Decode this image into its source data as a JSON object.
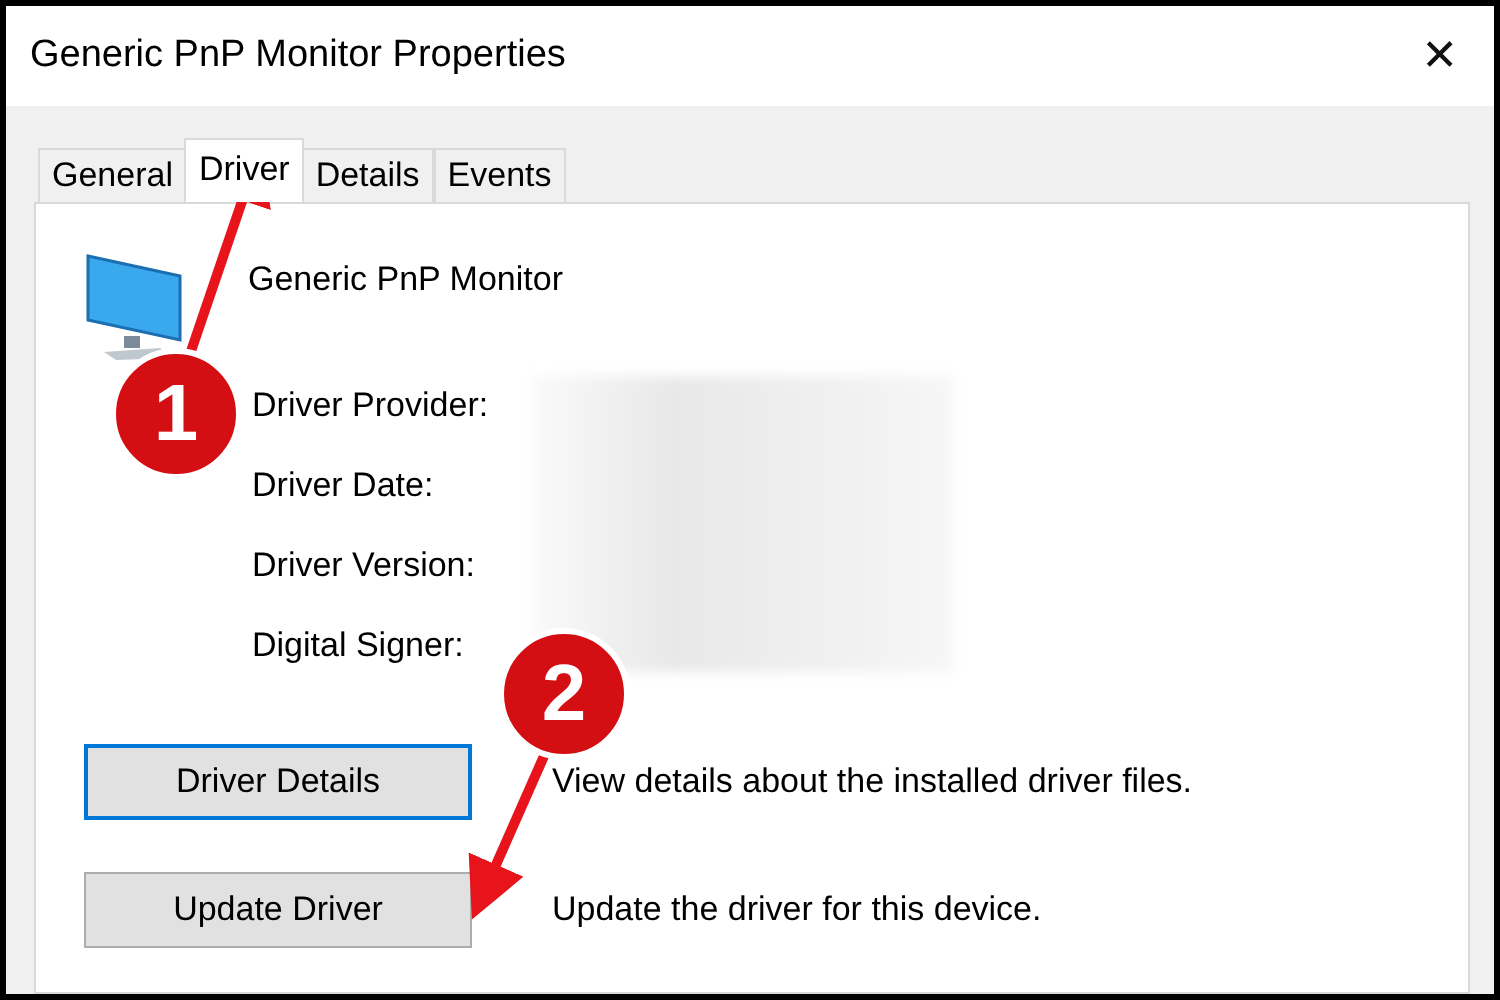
{
  "window": {
    "title": "Generic PnP Monitor Properties",
    "close": "✕"
  },
  "tabs": [
    {
      "label": "General",
      "selected": false
    },
    {
      "label": "Driver",
      "selected": true
    },
    {
      "label": "Details",
      "selected": false
    },
    {
      "label": "Events",
      "selected": false
    }
  ],
  "device": {
    "name": "Generic PnP Monitor"
  },
  "fields": [
    {
      "label": "Driver Provider:"
    },
    {
      "label": "Driver Date:"
    },
    {
      "label": "Driver Version:"
    },
    {
      "label": "Digital Signer:"
    }
  ],
  "actions": [
    {
      "button": "Driver Details",
      "description": "View details about the installed driver files.",
      "focused": true
    },
    {
      "button": "Update Driver",
      "description": "Update the driver for this device.",
      "focused": false
    }
  ],
  "annotations": [
    {
      "number": "1"
    },
    {
      "number": "2"
    }
  ]
}
